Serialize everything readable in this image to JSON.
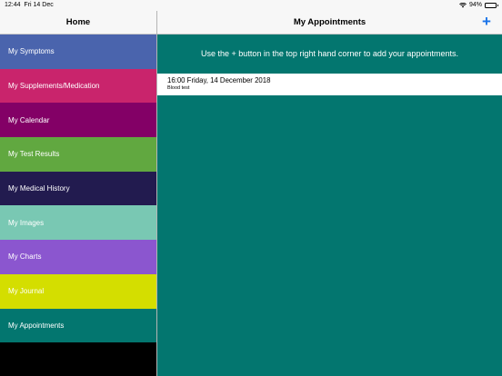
{
  "status_bar": {
    "time": "12:44",
    "date": "Fri 14 Dec",
    "battery": "94%",
    "battery_level": 0.94
  },
  "sidebar": {
    "title": "Home",
    "items": [
      {
        "label": "My Symptoms",
        "color": "#4a64ad"
      },
      {
        "label": "My Supplements/Medication",
        "color": "#c9246c"
      },
      {
        "label": "My Calendar",
        "color": "#830066"
      },
      {
        "label": "My Test Results",
        "color": "#61a840"
      },
      {
        "label": "My Medical History",
        "color": "#221b4f"
      },
      {
        "label": "My Images",
        "color": "#79c8b3"
      },
      {
        "label": "My Charts",
        "color": "#8b56cf"
      },
      {
        "label": "My Journal",
        "color": "#d4de00"
      },
      {
        "label": "My Appointments",
        "color": "#03766f"
      }
    ]
  },
  "main": {
    "title": "My Appointments",
    "add_icon": "plus-icon",
    "add_glyph": "+",
    "background": "#03766f",
    "hint": "Use the + button in the top right hand corner to add your appointments.",
    "appointments": [
      {
        "title": "16:00 Friday, 14 December 2018",
        "subtitle": "Blood test"
      }
    ]
  }
}
